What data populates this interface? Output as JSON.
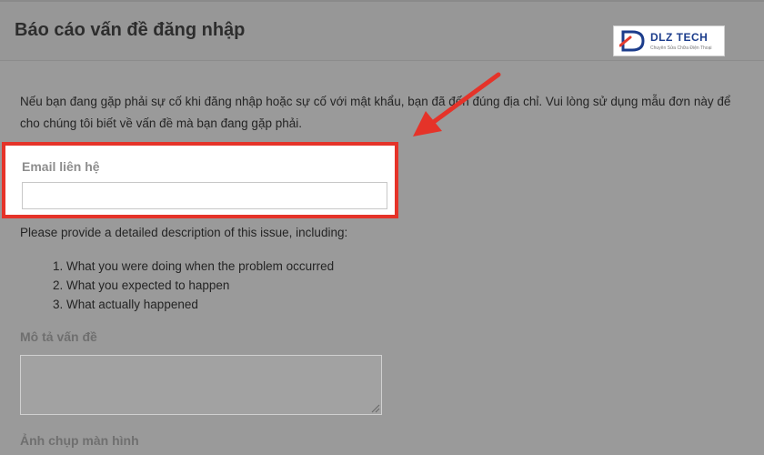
{
  "header": {
    "title": "Báo cáo vấn đề đăng nhập",
    "logo_text": "DLZ TECH",
    "logo_tagline": "Chuyên Sửa Chữa Điện Thoại"
  },
  "intro_text": "Nếu bạn đang gặp phải sự cố khi đăng nhập hoặc sự cố với mật khẩu, bạn đã đến đúng địa chỉ. Vui lòng sử dụng mẫu đơn này để cho chúng tôi biết về vấn đề mà bạn đang gặp phải.",
  "email": {
    "label": "Email liên hệ",
    "value": ""
  },
  "description": {
    "prompt": "Please provide a detailed description of this issue, including:",
    "steps": [
      "1. What you were doing when the problem occurred",
      "2. What you expected to happen",
      "3. What actually happened"
    ],
    "label": "Mô tả vấn đề"
  },
  "screenshot_label": "Ảnh chụp màn hình",
  "colors": {
    "highlight_border": "#e53329",
    "arrow": "#e53329",
    "logo_blue": "#1c3d8c"
  }
}
